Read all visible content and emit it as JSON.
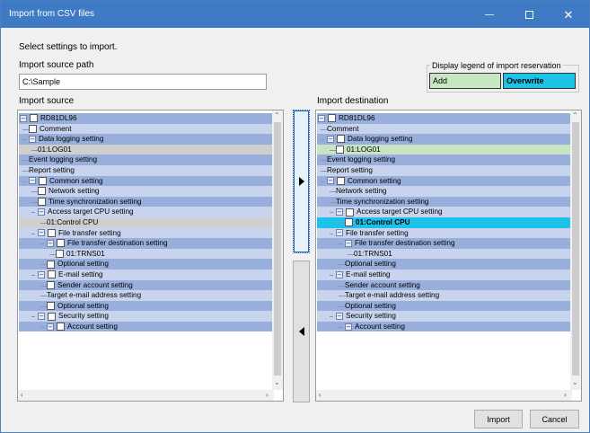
{
  "window": {
    "title": "Import from CSV files"
  },
  "labels": {
    "select_settings": "Select settings to import.",
    "source_path": "Import source path",
    "import_source": "Import source",
    "import_destination": "Import destination"
  },
  "source_path_value": "C:\\Sample",
  "legend": {
    "title": "Display legend of import reservation",
    "add": "Add",
    "overwrite": "Overwrite"
  },
  "colors": {
    "titlebar": "#3e7bc4",
    "row_dark": "#98aedb",
    "row_light": "#c8d4ee",
    "add": "#c6e7c1",
    "overwrite": "#1ec3ea"
  },
  "source_tree": [
    {
      "label": "RD81DL96",
      "indent": 0,
      "toggle": "⊟",
      "check": true,
      "bg": "dark"
    },
    {
      "label": "Comment",
      "indent": 1,
      "check": true,
      "bg": "light"
    },
    {
      "label": "Data logging setting",
      "indent": 1,
      "toggle": "⊟",
      "bg": "dark"
    },
    {
      "label": "01:LOG01",
      "indent": 2,
      "bg": "gray"
    },
    {
      "label": "Event logging setting",
      "indent": 1,
      "bg": "dark"
    },
    {
      "label": "Report setting",
      "indent": 1,
      "bg": "light"
    },
    {
      "label": "Common setting",
      "indent": 1,
      "toggle": "⊟",
      "check": true,
      "bg": "dark"
    },
    {
      "label": "Network setting",
      "indent": 2,
      "check": true,
      "bg": "light"
    },
    {
      "label": "Time synchronization setting",
      "indent": 2,
      "check": true,
      "bg": "dark"
    },
    {
      "label": "Access target CPU setting",
      "indent": 2,
      "toggle": "⊟",
      "bg": "light"
    },
    {
      "label": "01:Control CPU",
      "indent": 3,
      "bg": "gray"
    },
    {
      "label": "File transfer setting",
      "indent": 2,
      "toggle": "⊟",
      "check": true,
      "bg": "light"
    },
    {
      "label": "File transfer destination setting",
      "indent": 3,
      "toggle": "⊟",
      "check": true,
      "bg": "dark"
    },
    {
      "label": "01:TRNS01",
      "indent": 4,
      "check": true,
      "bg": "light"
    },
    {
      "label": "Optional setting",
      "indent": 3,
      "check": true,
      "bg": "dark"
    },
    {
      "label": "E-mail setting",
      "indent": 2,
      "toggle": "⊟",
      "check": true,
      "bg": "light"
    },
    {
      "label": "Sender account setting",
      "indent": 3,
      "check": true,
      "bg": "dark"
    },
    {
      "label": "Target e-mail address setting",
      "indent": 3,
      "bg": "light"
    },
    {
      "label": "Optional setting",
      "indent": 3,
      "check": true,
      "bg": "dark"
    },
    {
      "label": "Security setting",
      "indent": 2,
      "toggle": "⊟",
      "check": true,
      "bg": "light"
    },
    {
      "label": "Account setting",
      "indent": 3,
      "toggle": "⊟",
      "check": true,
      "bg": "dark"
    }
  ],
  "destination_tree": [
    {
      "label": "RD81DL96",
      "indent": 0,
      "toggle": "⊟",
      "check": true,
      "bg": "dark"
    },
    {
      "label": "Comment",
      "indent": 1,
      "bg": "light"
    },
    {
      "label": "Data logging setting",
      "indent": 1,
      "toggle": "⊟",
      "check": true,
      "bg": "dark"
    },
    {
      "label": "01:LOG01",
      "indent": 2,
      "check": true,
      "bg": "green"
    },
    {
      "label": "Event logging setting",
      "indent": 1,
      "bg": "dark"
    },
    {
      "label": "Report setting",
      "indent": 1,
      "bg": "light"
    },
    {
      "label": "Common setting",
      "indent": 1,
      "toggle": "⊟",
      "check": true,
      "bg": "dark"
    },
    {
      "label": "Network setting",
      "indent": 2,
      "bg": "light"
    },
    {
      "label": "Time synchronization setting",
      "indent": 2,
      "bg": "dark"
    },
    {
      "label": "Access target CPU setting",
      "indent": 2,
      "toggle": "⊟",
      "check": true,
      "bg": "light"
    },
    {
      "label": "01:Control CPU",
      "indent": 3,
      "check": true,
      "bg": "cyan"
    },
    {
      "label": "File transfer setting",
      "indent": 2,
      "toggle": "⊟",
      "bg": "light"
    },
    {
      "label": "File transfer destination setting",
      "indent": 3,
      "toggle": "⊟",
      "bg": "dark"
    },
    {
      "label": "01:TRNS01",
      "indent": 4,
      "bg": "light"
    },
    {
      "label": "Optional setting",
      "indent": 3,
      "bg": "dark"
    },
    {
      "label": "E-mail setting",
      "indent": 2,
      "toggle": "⊟",
      "bg": "light"
    },
    {
      "label": "Sender account setting",
      "indent": 3,
      "bg": "dark"
    },
    {
      "label": "Target e-mail address setting",
      "indent": 3,
      "bg": "light"
    },
    {
      "label": "Optional setting",
      "indent": 3,
      "bg": "dark"
    },
    {
      "label": "Security setting",
      "indent": 2,
      "toggle": "⊟",
      "bg": "light"
    },
    {
      "label": "Account setting",
      "indent": 3,
      "toggle": "⊟",
      "bg": "dark"
    }
  ],
  "buttons": {
    "import": "Import",
    "cancel": "Cancel"
  }
}
